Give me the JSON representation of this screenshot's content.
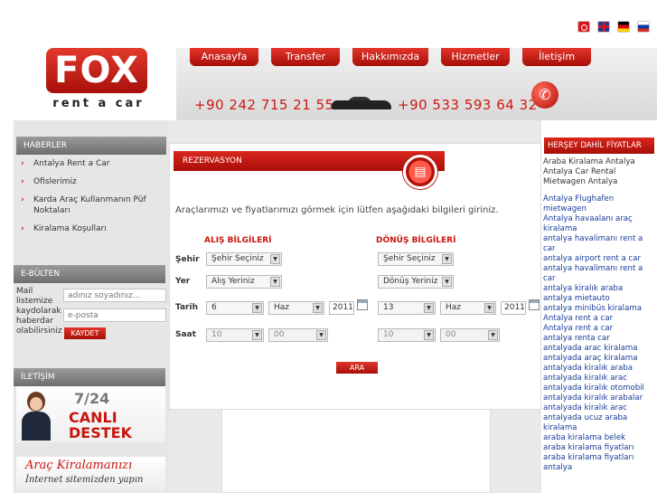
{
  "header": {
    "flags": [
      "Türkçe",
      "English",
      "Deutsch",
      "Русский"
    ],
    "logo": {
      "brand": "FOX",
      "tagline": "rent a car"
    },
    "nav": [
      "Anasayfa",
      "Transfer",
      "Hakkımızda",
      "Hizmetler",
      "İletişim"
    ],
    "phones": [
      "+90 242 715 21 55",
      "+90 533 593 64 32"
    ]
  },
  "news": {
    "title": "HABERLER",
    "items": [
      "Antalya Rent a Car",
      "Ofislerimiz",
      "Karda Araç Kullanmanın Püf Noktaları",
      "Kiralama Koşulları"
    ]
  },
  "bulletin": {
    "title": "E-BÜLTEN",
    "text": "Mail listemize kaydolarak haberdar olabilirsiniz",
    "name_placeholder": "adınız soyadınız...",
    "email_placeholder": "e-posta",
    "button": "KAYDET"
  },
  "contact": {
    "title": "İLETİŞİM",
    "line1": "7/24",
    "line2": "CANLI",
    "line3": "DESTEK"
  },
  "promo": {
    "line1": "Araç Kiralamanızı",
    "line2": "İnternet sitemizden yapın"
  },
  "reservation": {
    "title": "REZERVASYON",
    "intro": "Araçlarımızı ve fiyatlarımızı görmek için lütfen aşağıdaki bilgileri giriniz.",
    "pickup_title": "ALIŞ BİLGİLERİ",
    "return_title": "DÖNÜŞ BİLGİLERİ",
    "labels": {
      "city": "Şehir",
      "place": "Yer",
      "date": "Tarih",
      "time": "Saat"
    },
    "pickup": {
      "city": "Şehir Seçiniz",
      "place": "Alış Yeriniz",
      "day": "6",
      "month": "Haz",
      "year": "2011",
      "hour": "10",
      "minute": "00"
    },
    "return": {
      "city": "Şehir Seçiniz",
      "place": "Dönüş Yeriniz",
      "day": "13",
      "month": "Haz",
      "year": "2011",
      "hour": "10",
      "minute": "00"
    },
    "search_button": "ARA"
  },
  "prices": {
    "title": "HERŞEY DAHİL FİYATLAR",
    "links_dark": [
      "Araba Kiralama Antalya",
      "Antalya Car Rental",
      "Mietwagen Antalya"
    ],
    "links_blue": [
      "Antalya Flughafen mietwagen",
      "Antalya havaalanı araç kiralama",
      "antalya havalimanı rent a car",
      "antalya airport rent a car",
      "antalya havalimanı rent a car",
      "antalya kiralık araba",
      "antalya mietauto",
      "antalya minibüs kiralama",
      "Antalya rent a car",
      "Antalya rent a car",
      "antalya renta car",
      "antalyada arac kiralama",
      "antalyada araç kiralama",
      "antalyada kiralık araba",
      "antalyada kiralık arac",
      "antalyada kiralık otomobil",
      "antalyada kiralık arabalar",
      "antalyada kiralık arac",
      "antalyada ucuz araba kiralama",
      "araba kiralama belek",
      "araba kiralama fiyatları",
      "araba kiralama fiyatları",
      "antalya"
    ]
  }
}
